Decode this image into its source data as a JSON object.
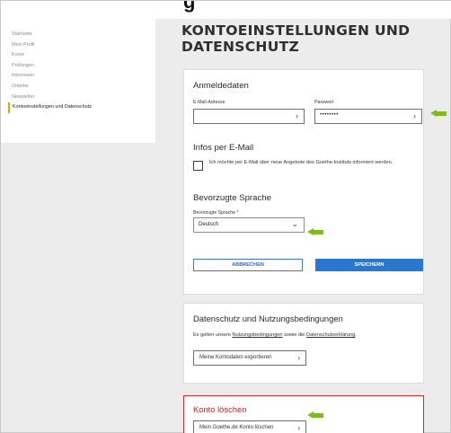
{
  "sidebar": {
    "items": [
      "Startseite",
      "Mein Profil",
      "Kurse",
      "Prüfungen",
      "Interessen",
      "Onleihe",
      "Newsletter",
      "Kontoeinstellungen und Datenschutz"
    ]
  },
  "page": {
    "title_line1": "KONTOEINSTELLUNGEN UND",
    "title_line2": "DATENSCHUTZ"
  },
  "login": {
    "heading": "Anmeldedaten",
    "email_label": "E-Mail-Adresse",
    "email_value": "",
    "password_label": "Passwort",
    "password_value": "••••••••"
  },
  "email_info": {
    "heading": "Infos per E-Mail",
    "checkbox_text": "Ich möchte per E-Mail über neue Angebote des Goethe-Instituts informiert werden."
  },
  "language": {
    "heading": "Bevorzugte Sprache",
    "label": "Bevorzugte Sprache *",
    "selected": "Deutsch"
  },
  "buttons": {
    "cancel": "ABBRECHEN",
    "save": "SPEICHERN"
  },
  "privacy": {
    "heading": "Datenschutz und Nutzungsbedingungen",
    "text_before": "Es gelten unsere ",
    "link1": "Nutzungsbedingungen",
    "text_middle": " sowie die ",
    "link2": "Datenschutzerklärung",
    "text_after": ".",
    "export_button": "Meine Kontodaten exportieren"
  },
  "delete": {
    "heading": "Konto löschen",
    "button": "Mein Goethe.de Konto löschen"
  },
  "colors": {
    "arrow": "#7dbb1f",
    "primary": "#2878cd",
    "danger": "#d22b2b",
    "active_marker": "#e5a800"
  }
}
